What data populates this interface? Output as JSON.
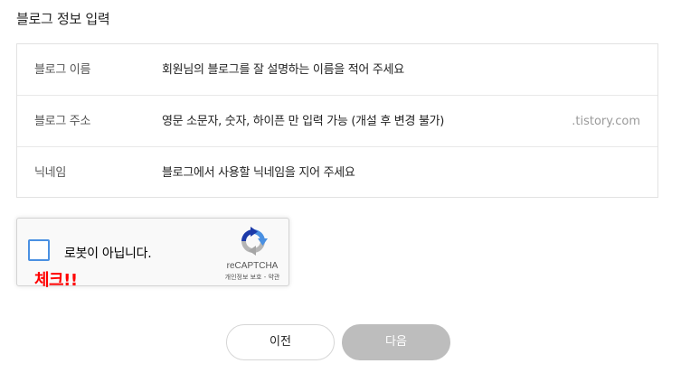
{
  "section": {
    "title": "블로그 정보 입력"
  },
  "form": {
    "rows": [
      {
        "label": "블로그 이름",
        "placeholder": "회원님의 블로그를 잘 설명하는 이름을 적어 주세요",
        "value": ""
      },
      {
        "label": "블로그 주소",
        "placeholder": "영문 소문자, 숫자, 하이픈 만 입력 가능 (개설 후 변경 불가)",
        "value": "",
        "suffix": ".tistory.com"
      },
      {
        "label": "닉네임",
        "placeholder": "블로그에서 사용할 닉네임을 지어 주세요",
        "value": ""
      }
    ]
  },
  "recaptcha": {
    "label": "로봇이 아닙니다.",
    "checked": false,
    "brand": "reCAPTCHA",
    "links": "개인정보 보호 - 약관",
    "checkbox_color": "#4a90e2"
  },
  "annotation": {
    "text": "체크!!",
    "color": "#ff0000"
  },
  "buttons": {
    "prev_label": "이전",
    "next_label": "다음",
    "next_disabled_color": "#bdbdbd"
  },
  "icons": {
    "recaptcha_logo": "recaptcha-logo-icon"
  }
}
